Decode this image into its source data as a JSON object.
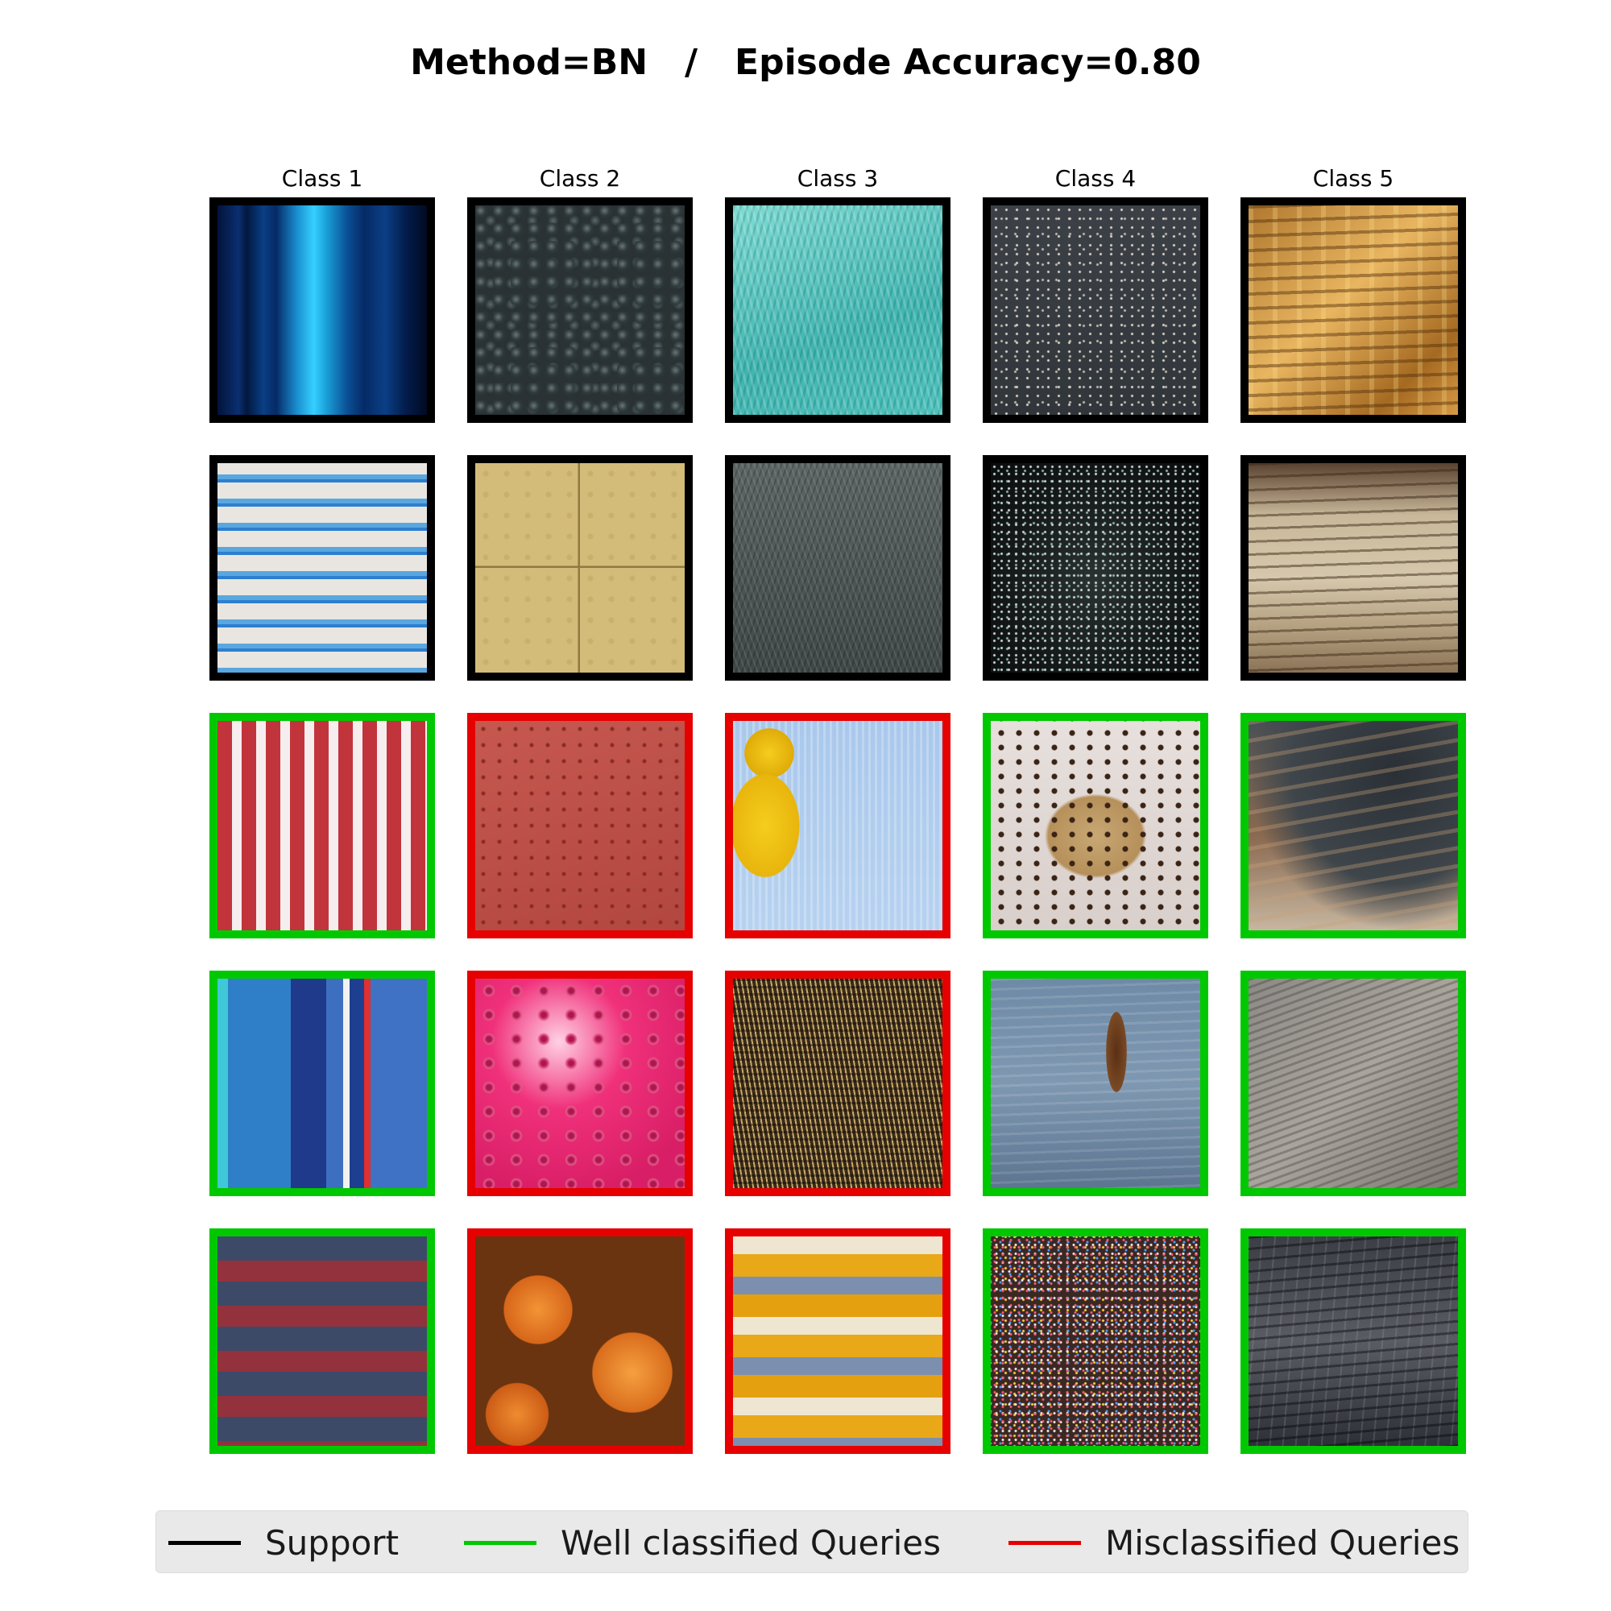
{
  "title": "Method=BN   /   Episode Accuracy=0.80",
  "classes": [
    "Class 1",
    "Class 2",
    "Class 3",
    "Class 4",
    "Class 5"
  ],
  "colors": {
    "support": "#000000",
    "well": "#00c800",
    "mis": "#e60000"
  },
  "rows": [
    [
      "support",
      "support",
      "support",
      "support",
      "support"
    ],
    [
      "support",
      "support",
      "support",
      "support",
      "support"
    ],
    [
      "well",
      "mis",
      "mis",
      "well",
      "well"
    ],
    [
      "well",
      "mis",
      "mis",
      "well",
      "well"
    ],
    [
      "well",
      "mis",
      "mis",
      "well",
      "well"
    ]
  ],
  "textures": [
    [
      "blue-vertical-stripes",
      "grey-bubbles",
      "teal-knit",
      "grey-speckled-stone",
      "golden-layered-rock"
    ],
    [
      "blue-white-horizontal-stripes",
      "tan-tactile-paving",
      "grey-knit",
      "sparkly-dark-surface",
      "layered-sandstone"
    ],
    [
      "red-white-vertical-stripes",
      "red-tactile-paving",
      "yellow-teddy-blue-knit",
      "cookie-dough",
      "dark-slate-rock"
    ],
    [
      "blue-vertical-stripes-wide",
      "pink-spiky-ball",
      "brown-knit",
      "weathered-blue-wood",
      "grey-layered-rock"
    ],
    [
      "red-navy-horizontal-stripes",
      "orange-pumpkins",
      "yellow-grey-crochet",
      "chocolate-sprinkles",
      "dark-cliff-rock"
    ]
  ],
  "legend": [
    {
      "key": "support",
      "label": "Support"
    },
    {
      "key": "well",
      "label": "Well classified Queries"
    },
    {
      "key": "mis",
      "label": "Misclassified Queries"
    }
  ]
}
